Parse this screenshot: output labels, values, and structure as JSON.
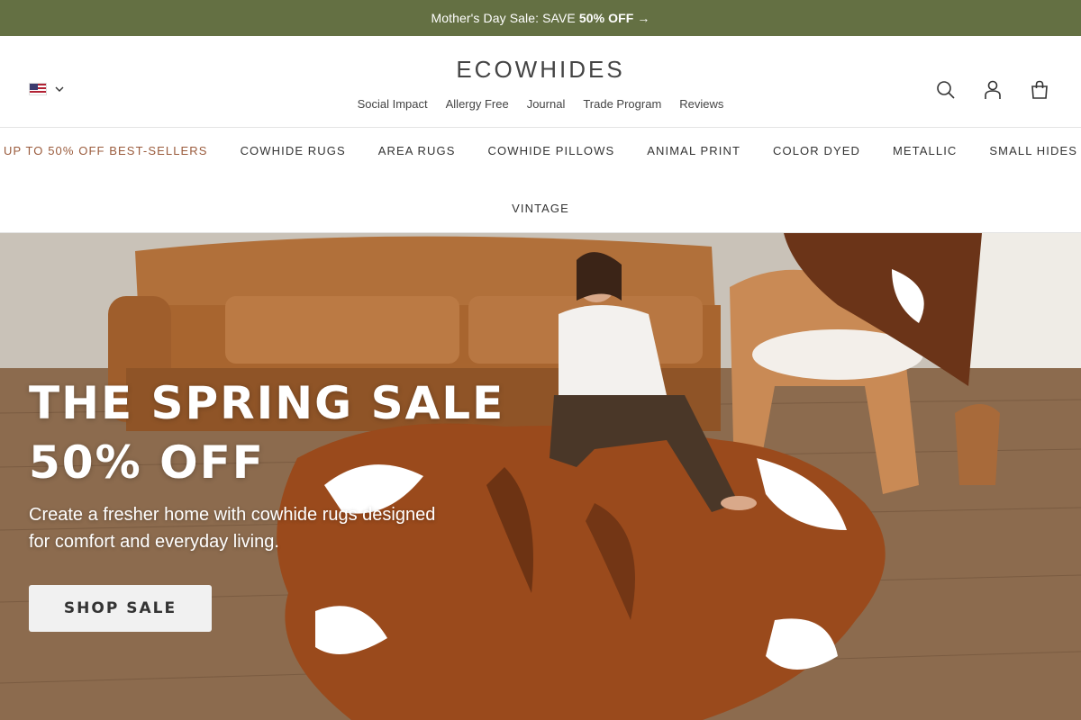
{
  "announcement": {
    "text": "Mother's Day Sale: SAVE",
    "highlight": "50% OFF",
    "arrow": "→"
  },
  "header": {
    "logo": "ECOWHIDES",
    "locale_icon": "us-flag-icon",
    "utility_links": [
      "Social Impact",
      "Allergy Free",
      "Journal",
      "Trade Program",
      "Reviews"
    ],
    "icons": [
      "search-icon",
      "account-icon",
      "cart-icon"
    ]
  },
  "nav": {
    "items": [
      "UP TO 50% OFF BEST-SELLERS",
      "COWHIDE RUGS",
      "AREA RUGS",
      "COWHIDE PILLOWS",
      "ANIMAL PRINT",
      "COLOR DYED",
      "METALLIC",
      "SMALL HIDES"
    ],
    "second_row": "VINTAGE"
  },
  "hero": {
    "title_line1": "THE SPRING SALE",
    "title_line2": "50% OFF",
    "subtitle": "Create a fresher home with cowhide rugs designed for comfort and everyday living.",
    "button": "SHOP SALE"
  },
  "colors": {
    "announcement_bg": "#647043",
    "sale_link": "#9a5b3c",
    "button_bg": "#f1f1f1"
  }
}
